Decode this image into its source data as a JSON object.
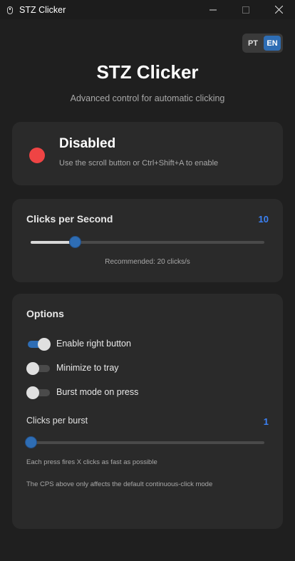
{
  "window": {
    "title": "STZ Clicker",
    "controls": {
      "minimize": "—",
      "maximize": "☐",
      "close": "✕"
    }
  },
  "language": {
    "options": [
      "PT",
      "EN"
    ],
    "selected": "EN"
  },
  "header": {
    "title": "STZ Clicker",
    "subtitle": "Advanced control for automatic clicking"
  },
  "status": {
    "title": "Disabled",
    "hint": "Use the scroll button or Ctrl+Shift+A to enable",
    "color": "#ef4444"
  },
  "cps": {
    "label": "Clicks per Second",
    "value": "10",
    "slider_fraction": 0.19,
    "recommendation": "Recommended: 20 clicks/s"
  },
  "options": {
    "title": "Options",
    "toggles": [
      {
        "label": "Enable right button",
        "on": true
      },
      {
        "label": "Minimize to tray",
        "on": false
      },
      {
        "label": "Burst mode on press",
        "on": false
      }
    ],
    "burst": {
      "label": "Clicks per burst",
      "value": "1",
      "slider_fraction": 0
    },
    "notes": [
      "Each press fires X clicks as fast as possible",
      "The CPS above only affects the default continuous-click mode"
    ]
  },
  "colors": {
    "accent": "#2e6db4",
    "accent_text": "#3b82f6",
    "background": "#1f1f1f",
    "card": "#2a2a2a"
  }
}
